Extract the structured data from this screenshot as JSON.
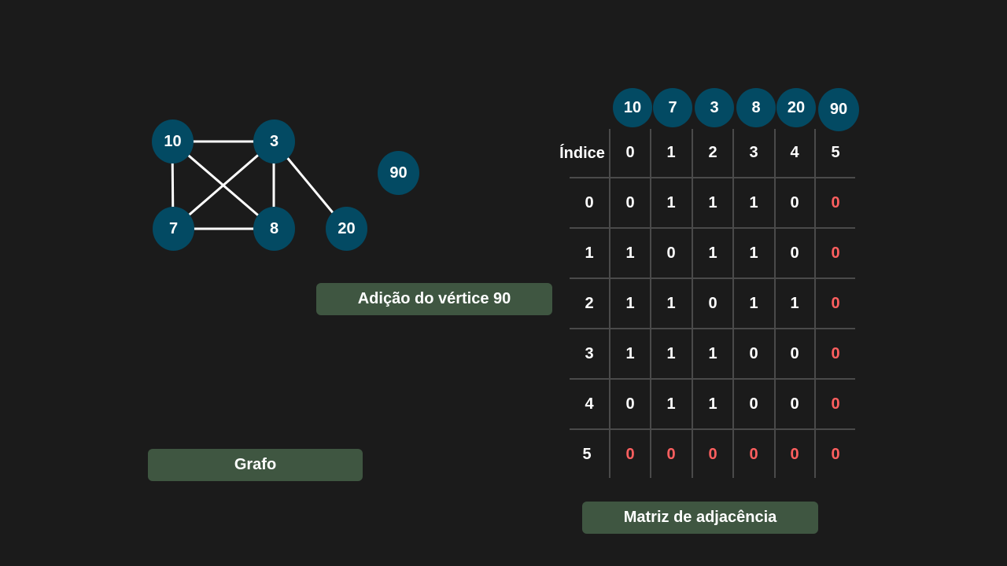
{
  "colors": {
    "background": "#1b1b1b",
    "node_fill": "#034a63",
    "edge": "#ffffff",
    "label_box": "#3f5641",
    "new_entry": "#ff5f5f",
    "grid_line": "#4a4a4a"
  },
  "graph": {
    "nodes": [
      "10",
      "3",
      "7",
      "8",
      "20",
      "90"
    ],
    "edges": [
      [
        "10",
        "3"
      ],
      [
        "10",
        "7"
      ],
      [
        "10",
        "8"
      ],
      [
        "3",
        "7"
      ],
      [
        "3",
        "8"
      ],
      [
        "3",
        "20"
      ],
      [
        "7",
        "8"
      ]
    ],
    "caption": "Grafo"
  },
  "action_label": "Adição do vértice 90",
  "matrix": {
    "caption": "Matriz de adjacência",
    "index_label": "Índice",
    "vertex_header": [
      "10",
      "7",
      "3",
      "8",
      "20",
      "90"
    ],
    "column_indices": [
      "0",
      "1",
      "2",
      "3",
      "4",
      "5"
    ],
    "row_indices": [
      "0",
      "1",
      "2",
      "3",
      "4",
      "5"
    ],
    "rows": [
      [
        "0",
        "1",
        "1",
        "1",
        "0",
        "0"
      ],
      [
        "1",
        "0",
        "1",
        "1",
        "0",
        "0"
      ],
      [
        "1",
        "1",
        "0",
        "1",
        "1",
        "0"
      ],
      [
        "1",
        "1",
        "1",
        "0",
        "0",
        "0"
      ],
      [
        "0",
        "1",
        "1",
        "0",
        "0",
        "0"
      ],
      [
        "0",
        "0",
        "0",
        "0",
        "0",
        "0"
      ]
    ],
    "new_vertex_index": 5
  }
}
